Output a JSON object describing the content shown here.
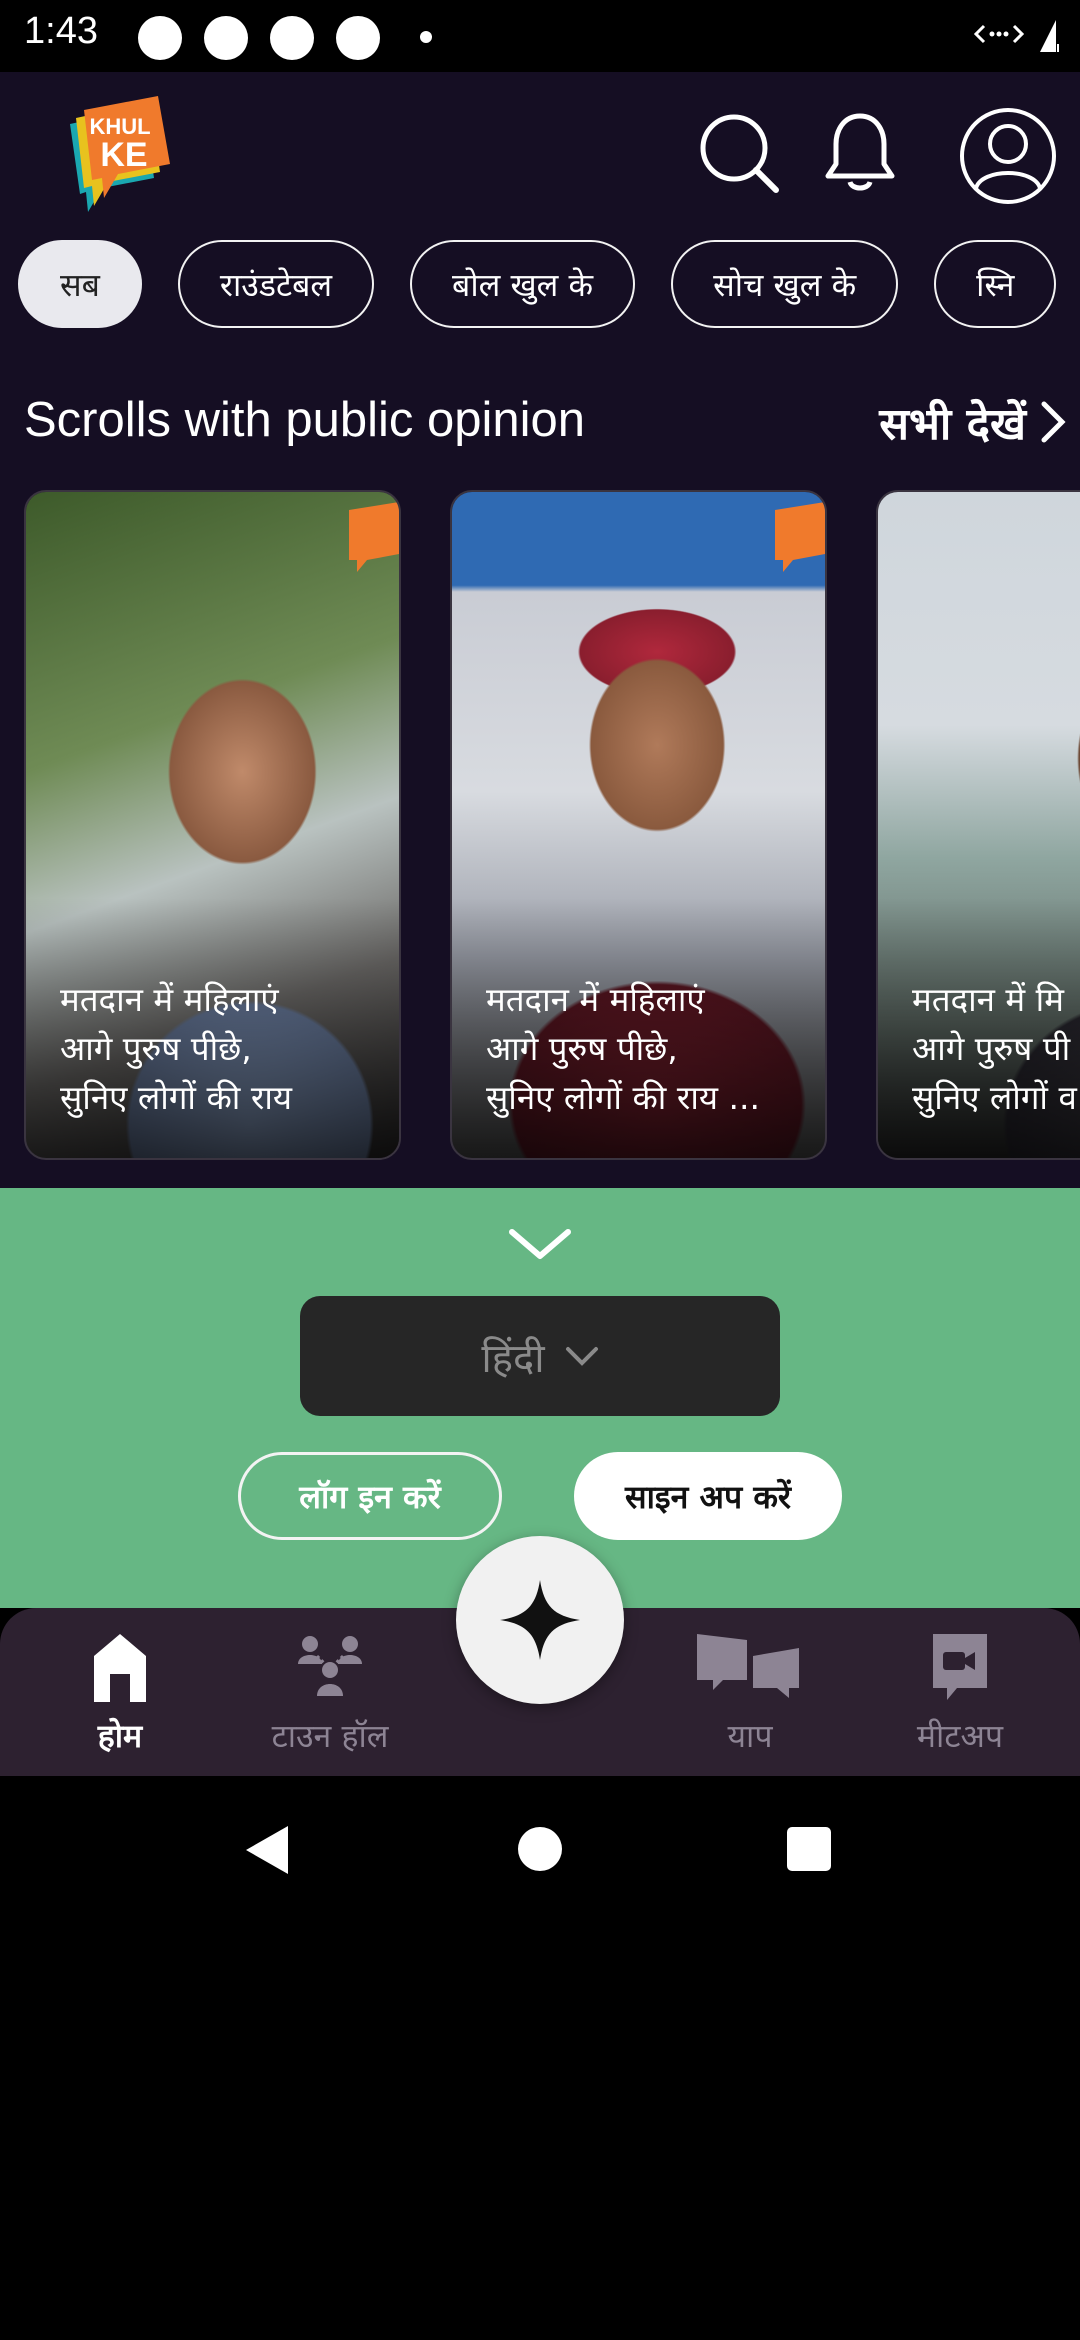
{
  "status_bar": {
    "time": "1:43"
  },
  "header": {
    "logo_text_top": "KHUL",
    "logo_text_bottom": "KE"
  },
  "filters": [
    "सब",
    "राउंडटेबल",
    "बोल खुल के",
    "सोच खुल के",
    "स्नि"
  ],
  "section": {
    "title": "Scrolls with public opinion",
    "see_all": "सभी देखें"
  },
  "cards": [
    {
      "caption": "मतदान में महिलाएं\nआगे पुरुष पीछे,\nसुनिए लोगों की राय"
    },
    {
      "caption": "मतदान में महिलाएं\nआगे पुरुष पीछे,\nसुनिए लोगों की राय ..."
    },
    {
      "caption": "मतदान में मि\nआगे पुरुष पी\nसुनिए लोगों व"
    }
  ],
  "sheet": {
    "language": "हिंदी",
    "login": "लॉग इन करें",
    "signup": "साइन अप करें"
  },
  "bottom_nav": {
    "home": "होम",
    "townhall": "टाउन हॉल",
    "yap": "याप",
    "meetup": "मीटअप"
  },
  "colors": {
    "app_bg": "#150e23",
    "sheet_bg": "#66b784",
    "nav_bg": "#2d2130",
    "brand_orange": "#f07a2c"
  }
}
